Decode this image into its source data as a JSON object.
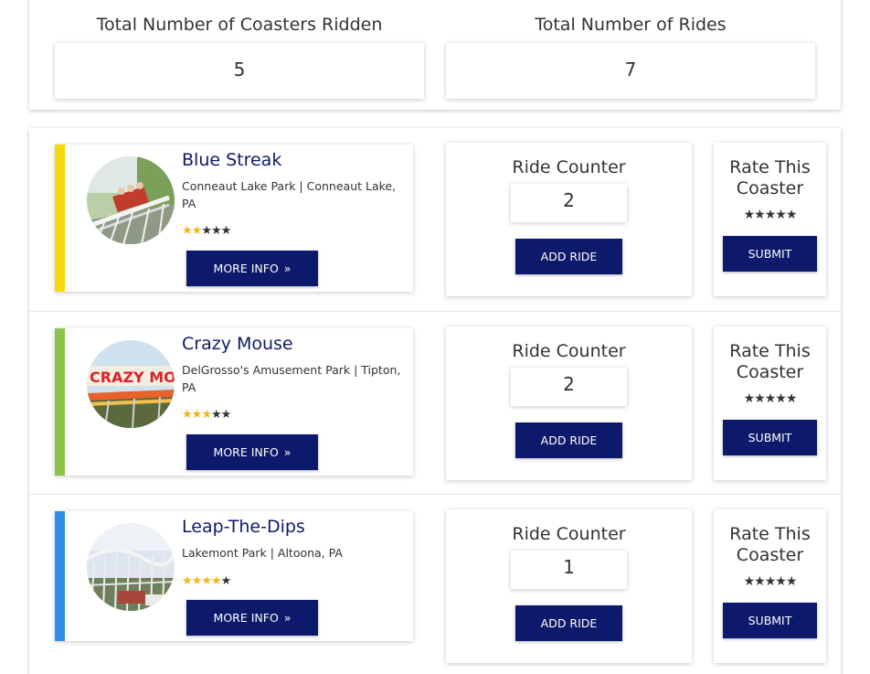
{
  "summary": {
    "coasters_title": "Total Number of Coasters Ridden",
    "coasters_value": "5",
    "rides_title": "Total Number of Rides",
    "rides_value": "7"
  },
  "coasters": [
    {
      "name": "Blue Streak",
      "location": "Conneaut Lake Park | Conneaut Lake, PA",
      "rating": 2,
      "accent_color": "#f5d90a",
      "more_info_label": "MORE INFO",
      "counter_title": "Ride Counter",
      "ride_count": "2",
      "add_ride_label": "ADD RIDE",
      "rate_title": "Rate This Coaster",
      "submit_label": "SUBMIT"
    },
    {
      "name": "Crazy Mouse",
      "location": "DelGrosso's Amusement Park | Tipton, PA",
      "rating": 3,
      "accent_color": "#8bc34a",
      "more_info_label": "MORE INFO",
      "counter_title": "Ride Counter",
      "ride_count": "2",
      "add_ride_label": "ADD RIDE",
      "rate_title": "Rate This Coaster",
      "submit_label": "SUBMIT"
    },
    {
      "name": "Leap-The-Dips",
      "location": "Lakemont Park | Altoona, PA",
      "rating": 4,
      "accent_color": "#2f8fe8",
      "more_info_label": "MORE INFO",
      "counter_title": "Ride Counter",
      "ride_count": "1",
      "add_ride_label": "ADD RIDE",
      "rate_title": "Rate This Coaster",
      "submit_label": "SUBMIT"
    }
  ],
  "rating_max": 5,
  "icons": {
    "star": "star-icon",
    "more_info": "double-chevron-right-icon"
  },
  "colors": {
    "primary_button": "#0d1a6b",
    "title_text": "#0d1a6b",
    "star_filled": "#f2b61b"
  }
}
